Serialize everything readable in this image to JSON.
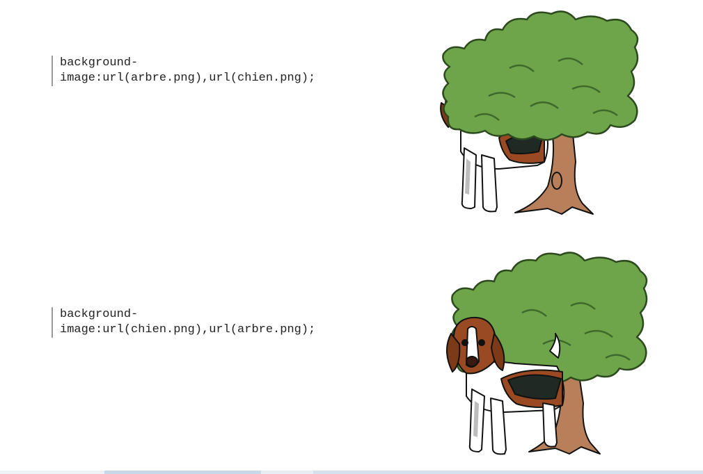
{
  "examples": [
    {
      "code_line1": "background-",
      "code_line2": "image:url(arbre.png),url(chien.png);",
      "illustration": "tree-in-front-of-dog-icon"
    },
    {
      "code_line1": "background-",
      "code_line2": "image:url(chien.png),url(arbre.png);",
      "illustration": "dog-in-front-of-tree-icon"
    }
  ],
  "colors": {
    "foliage": "#6ea54a",
    "foliage_dark": "#3d6a2a",
    "trunk": "#b8805a",
    "dog_brown": "#9a4a22",
    "dog_black": "#1f2a24",
    "dog_white": "#ffffff"
  }
}
